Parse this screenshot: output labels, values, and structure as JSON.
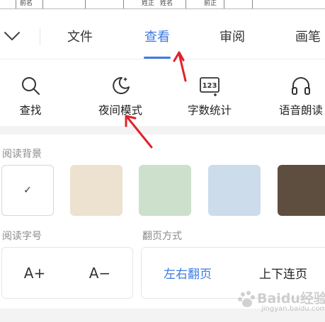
{
  "doc_strip": {
    "cells": [
      "前名",
      "姓正",
      "姓名",
      "前正"
    ]
  },
  "tabs": {
    "items": [
      {
        "label": "文件",
        "active": false
      },
      {
        "label": "查看",
        "active": true
      },
      {
        "label": "审阅",
        "active": false
      },
      {
        "label": "画笔",
        "active": false
      }
    ]
  },
  "tools": [
    {
      "label": "查找",
      "icon": "search-icon"
    },
    {
      "label": "夜间模式",
      "icon": "night-mode-icon"
    },
    {
      "label": "字数统计",
      "icon": "word-count-icon",
      "icon_text": "123"
    },
    {
      "label": "语音朗读",
      "icon": "headphones-icon"
    }
  ],
  "reading_background": {
    "title": "阅读背景",
    "swatches": [
      {
        "color": "#ffffff",
        "selected": true
      },
      {
        "color": "#ede2cf",
        "selected": false
      },
      {
        "color": "#cde0cc",
        "selected": false
      },
      {
        "color": "#cddceb",
        "selected": false
      },
      {
        "color": "#5e4e40",
        "selected": false
      }
    ],
    "check_mark": "✓"
  },
  "font_size": {
    "title": "阅读字号",
    "increase": "A+",
    "decrease": "A−"
  },
  "page_flip": {
    "title": "翻页方式",
    "options": [
      {
        "label": "左右翻页",
        "selected": true
      },
      {
        "label": "上下连页",
        "selected": false
      }
    ]
  },
  "colors": {
    "accent": "#3d7be1",
    "annotation": "#e0222a"
  },
  "watermark": {
    "text": "Baidu经验",
    "sub": "jingyan.baidu.com"
  }
}
